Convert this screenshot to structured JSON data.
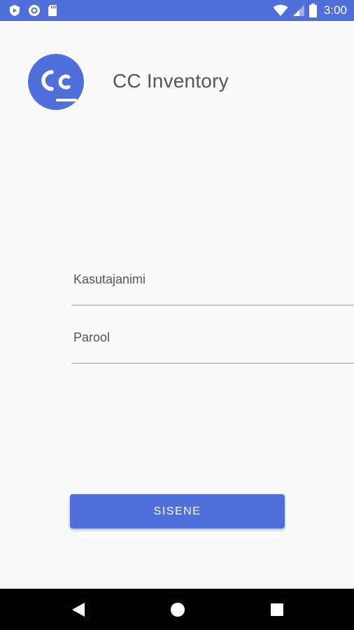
{
  "status_bar": {
    "time": "3:00",
    "color": "#4f6fdb",
    "left_icons": [
      "play-protect-icon",
      "sync-circle-icon",
      "sd-card-icon"
    ],
    "right_icons": [
      "wifi-icon",
      "cell-signal-icon",
      "battery-icon"
    ]
  },
  "header": {
    "app_title": "CC Inventory",
    "logo_text": "Cc"
  },
  "form": {
    "username_label": "Kasutajanimi",
    "password_label": "Parool",
    "login_label": "SISENE"
  },
  "nav_bar": {
    "icons": [
      "back-icon",
      "home-icon",
      "recents-icon"
    ]
  },
  "colors": {
    "accent": "#4f6fdb",
    "background": "#fafafa",
    "text": "#555555"
  }
}
